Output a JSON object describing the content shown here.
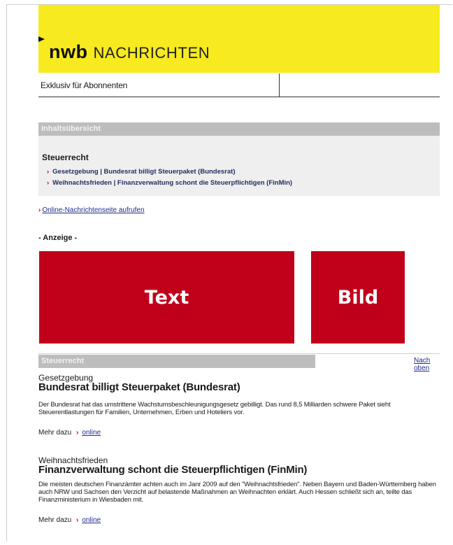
{
  "header": {
    "brand_bold": "nwb",
    "brand_light": "NACHRICHTEN",
    "subtitle": "Exklusiv für Abonnenten"
  },
  "toc": {
    "heading": "Inhaltsübersicht",
    "section_title": "Steuerrecht",
    "items": [
      {
        "label": "Gesetzgebung | Bundesrat billigt Steuerpaket (Bundesrat)"
      },
      {
        "label": "Weihnachtsfrieden | Finanzverwaltung schont die Steuerpflichtigen (FinMin)"
      }
    ],
    "caret": "›"
  },
  "online_link": "Online-Nachrichtenseite aufrufen",
  "ad": {
    "label": "- Anzeige -",
    "text_block": "Text",
    "image_block": "Bild"
  },
  "section": {
    "heading": "Steuerrecht",
    "top_link": "Nach oben"
  },
  "articles": [
    {
      "category": "Gesetzgebung",
      "title": "Bundesrat billigt Steuerpaket (Bundesrat)",
      "body": "Der Bundesrat hat das umstrittene Wachstumsbeschleunigungsgesetz gebilligt. Das rund 8,5 Milliarden schwere Paket sieht Steuerentlastungen für Familien, Unternehmen, Erben und Hoteliers vor.",
      "more_label": "Mehr dazu",
      "more_link": "online"
    },
    {
      "category": "Weihnachtsfrieden",
      "title": "Finanzverwaltung schont die Steuerpflichtigen (FinMin)",
      "body": "Die meisten deutschen Finanzämter achten auch im Janr 2009 auf den \"Weihnachtsfrieden\". Neben Bayern und Baden-Württemberg haben auch NRW und Sachsen den Verzicht auf belastende Maßnahmen an Weihnachten erklärt. Auch Hessen schließt sich an, teilte das Finanzministerium in Wiesbaden mit.",
      "more_label": "Mehr dazu",
      "more_link": "online"
    }
  ],
  "colors": {
    "header_yellow": "#f7ea1e",
    "ad_red": "#c0001a",
    "gray_bar": "#bdbdbd",
    "link_blue": "#1f2c8c"
  }
}
